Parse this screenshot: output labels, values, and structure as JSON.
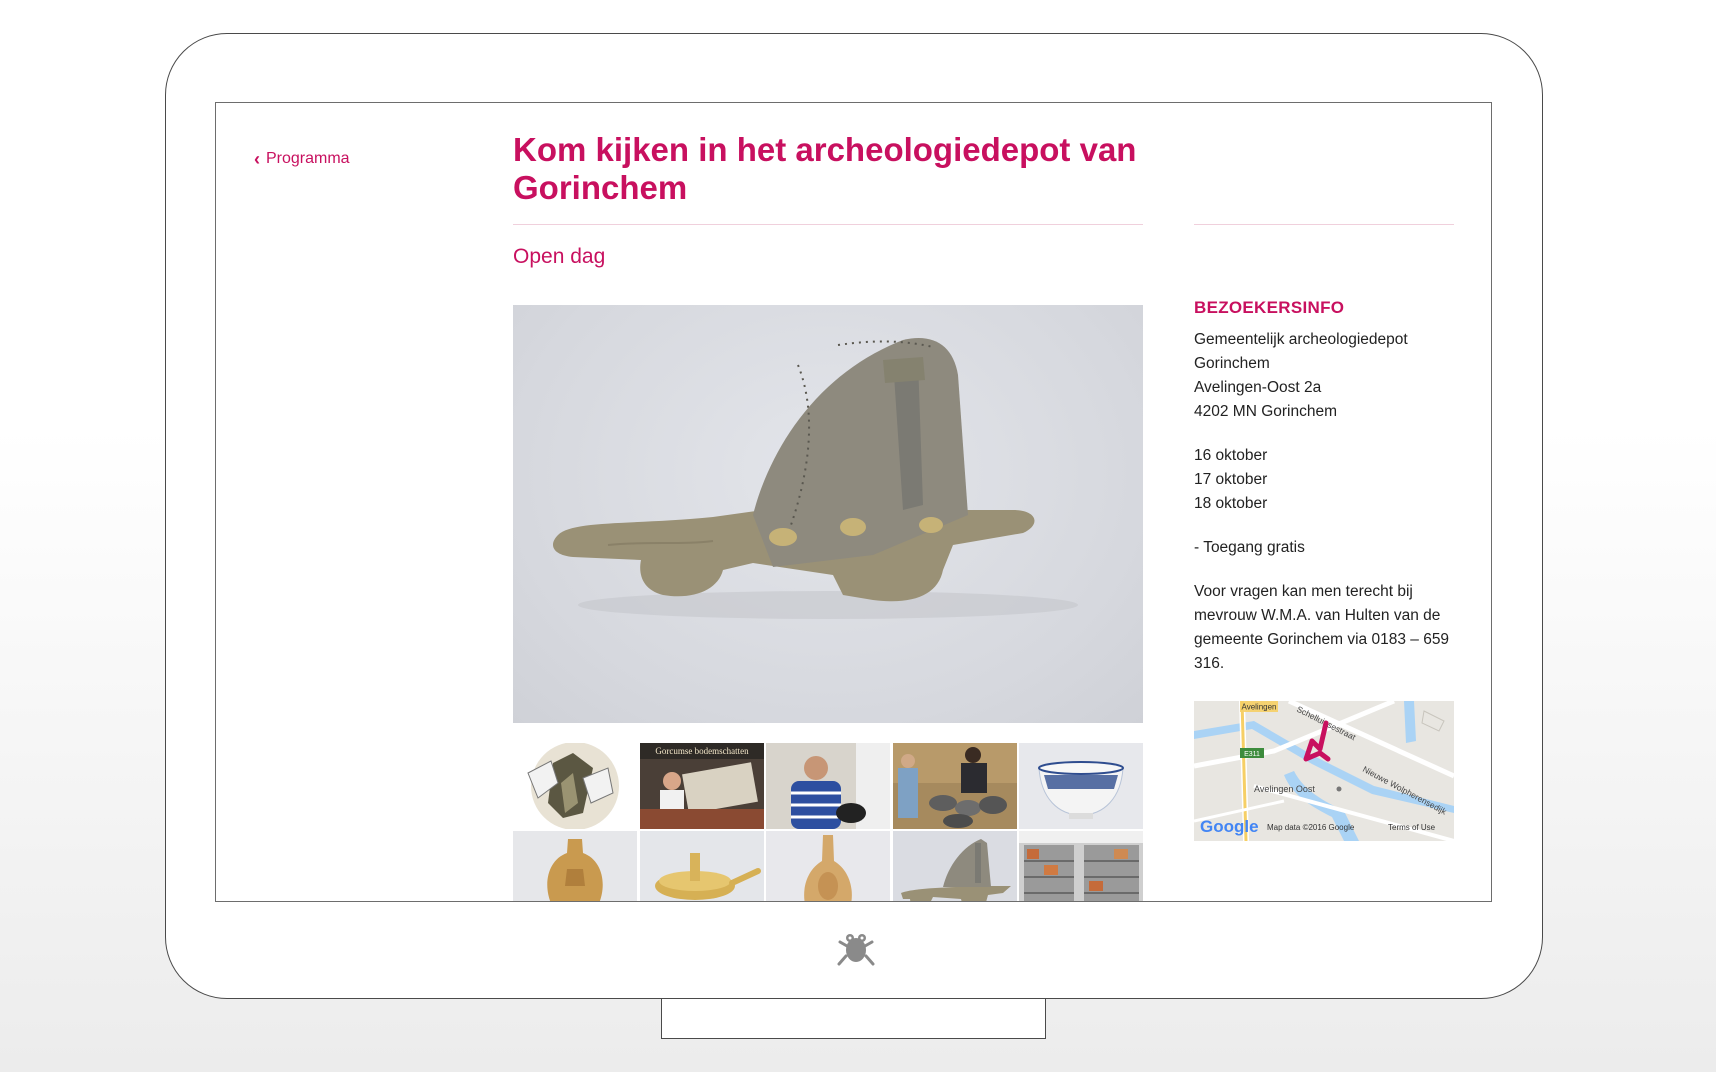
{
  "nav": {
    "back_label": "Programma"
  },
  "event": {
    "title": "Kom kijken in het archeologiedepot van Gorinchem",
    "subtitle": "Open dag"
  },
  "visitor_info": {
    "heading": "BEZOEKERSINFO",
    "address": [
      "Gemeentelijk archeologiedepot",
      "Gorinchem",
      "Avelingen-Oost 2a",
      "4202 MN Gorinchem"
    ],
    "dates": [
      "16 oktober",
      "17 oktober",
      "18 oktober"
    ],
    "admission": "- Toegang gratis",
    "contact": "Voor vragen kan men terecht bij mevrouw W.M.A. van Hulten van de gemeente Gorinchem via 0183 – 659 316."
  },
  "gallery": {
    "thumbnail_text": "Gorcumse bodemschatten",
    "thumb_count": 10
  },
  "map": {
    "labels": {
      "avelingen": "Avelingen",
      "street1": "Schelluinsestraat",
      "road": "E311",
      "area": "Avelingen Oost",
      "street2": "Nieuwe Wolpherensedijk"
    },
    "brand": "Google",
    "attribution": "Map data ©2016 Google",
    "terms": "Terms of Use"
  },
  "colors": {
    "accent": "#c8105f",
    "text": "#222222"
  }
}
